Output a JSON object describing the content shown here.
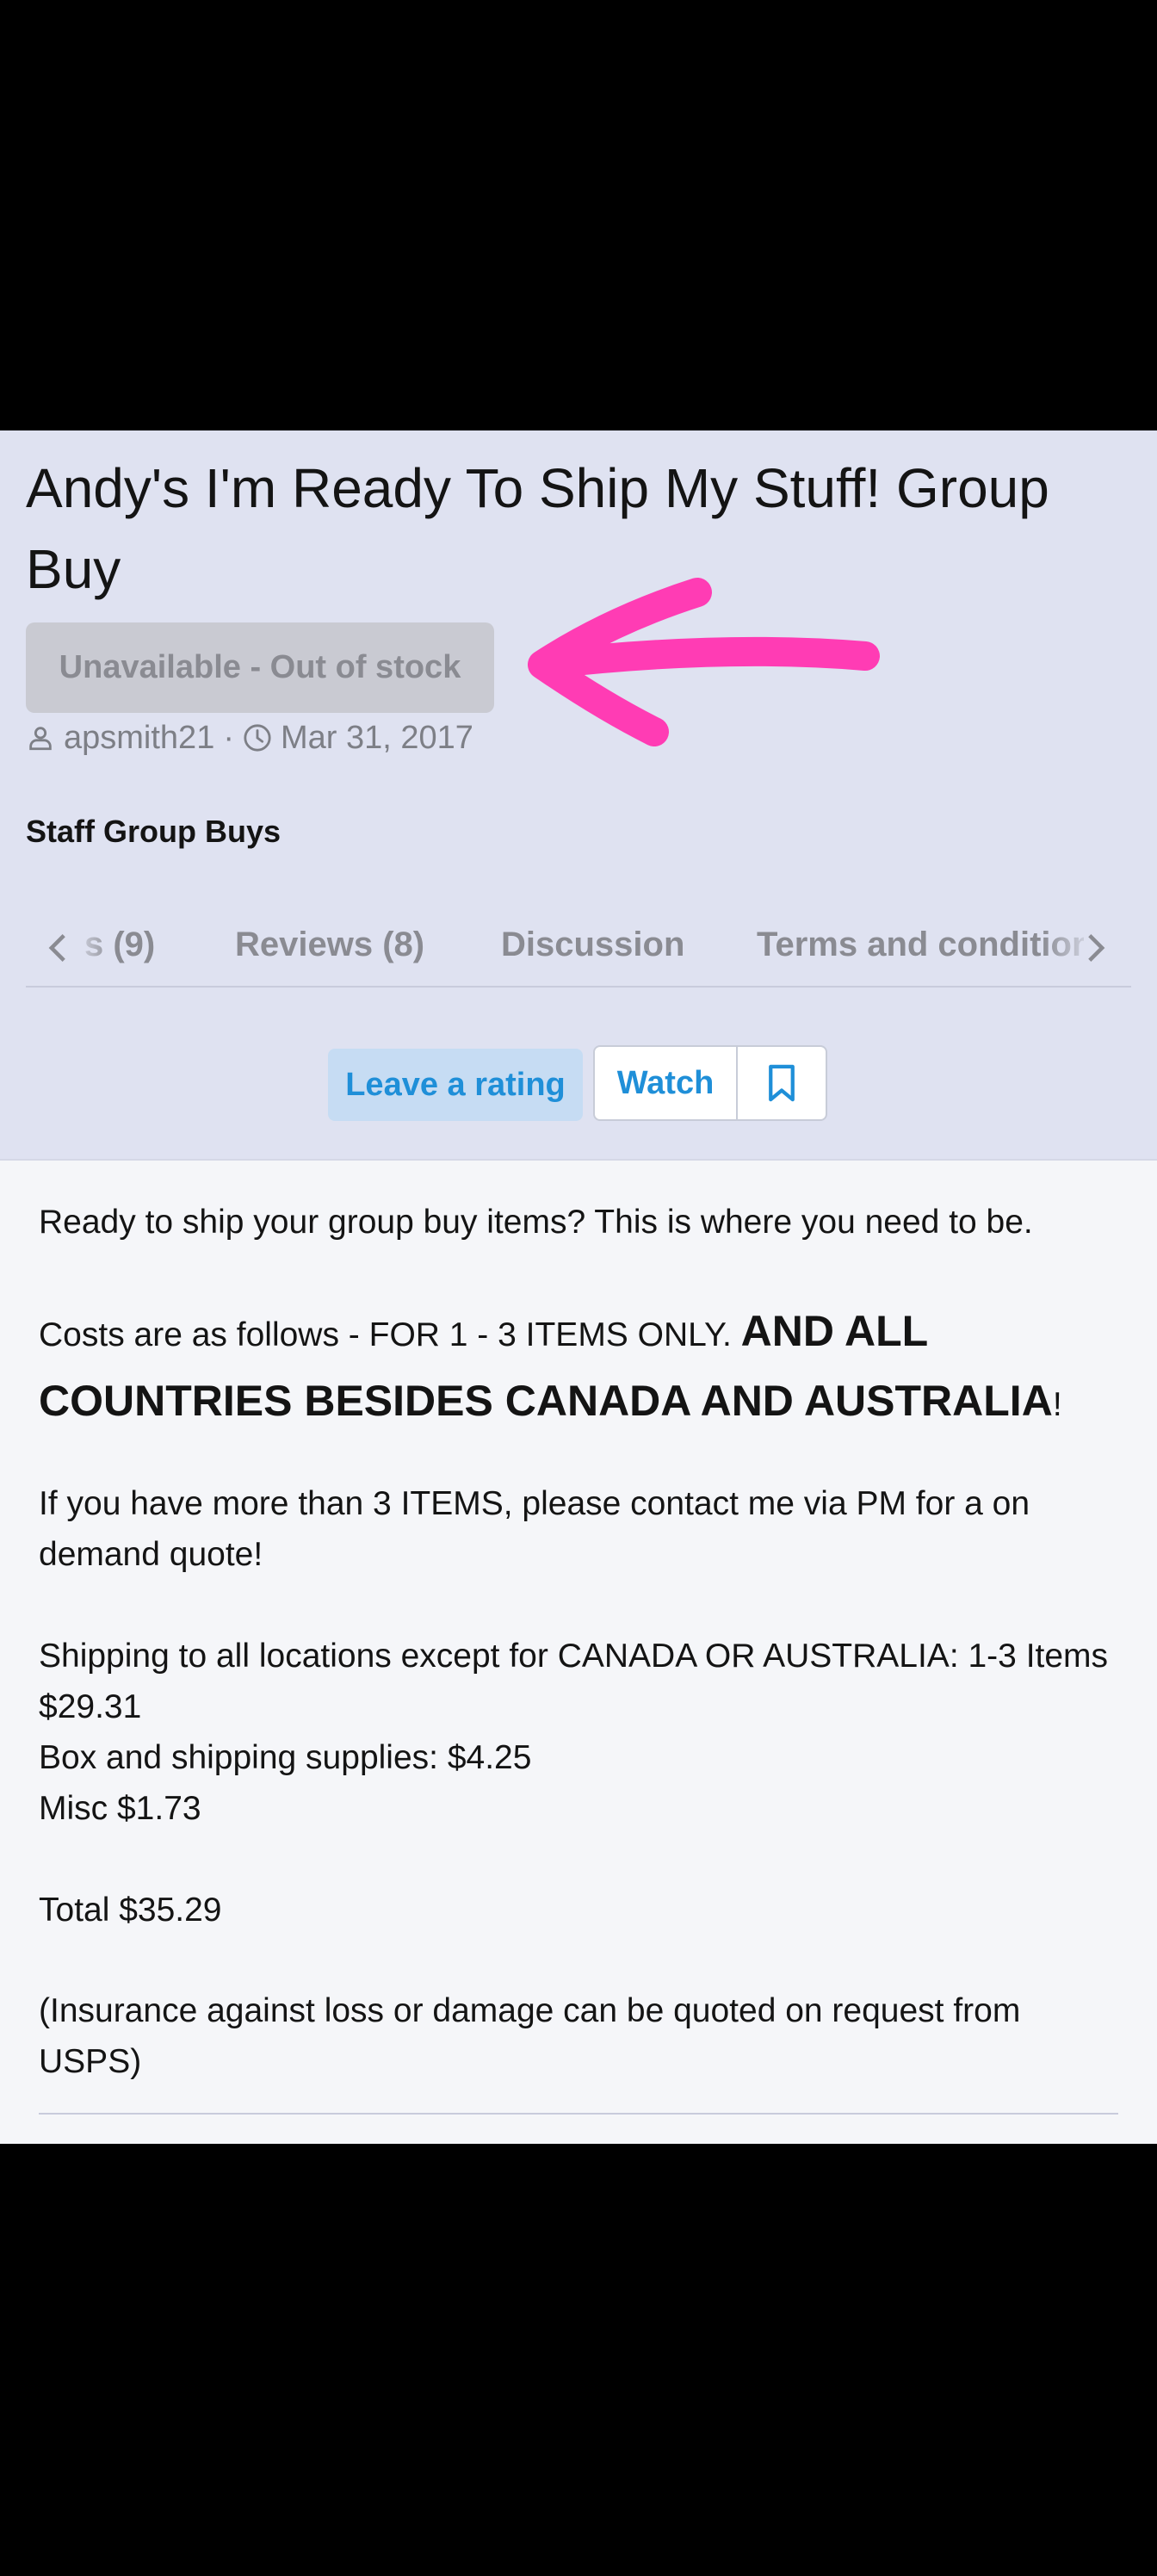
{
  "thread": {
    "title": "Andy's I'm Ready To Ship My Stuff! Group Buy",
    "status_label": "Unavailable - Out of stock",
    "author": "apsmith21",
    "date": "Mar 31, 2017",
    "category": "Staff Group Buys"
  },
  "annotation": {
    "color": "#ff3cb4",
    "icon": "pink-arrow-annotation"
  },
  "tabs": {
    "partial": "s (9)",
    "reviews": "Reviews (8)",
    "discussion": "Discussion",
    "terms": "Terms and conditions",
    "prev_icon": "chevron-left-icon",
    "next_icon": "chevron-right-icon"
  },
  "actions": {
    "rating": "Leave a rating",
    "watch": "Watch",
    "bookmark_icon": "bookmark-icon"
  },
  "body": {
    "p1": "Ready to ship your group buy items? This is where you need to be.",
    "p2_a": "Costs are as follows - FOR 1 - 3 ITEMS ONLY. ",
    "p2_b": "AND ALL COUNTRIES BESIDES CANADA AND AUSTRALIA",
    "p2_c": "!",
    "p3": "If you have more than 3 ITEMS, please contact me via PM for a on demand quote!",
    "p4_1": "Shipping to all locations except for CANADA OR AUSTRALIA: 1-3 Items $29.31",
    "p4_2": "Box and shipping supplies: $4.25",
    "p4_3": "Misc $1.73",
    "p5": "Total $35.29",
    "p6": "(Insurance against loss or damage can be quoted on request from USPS)"
  },
  "colors": {
    "accent": "#1f8fd8",
    "header_bg": "#dfe2f1",
    "content_bg": "#f5f6f9"
  }
}
